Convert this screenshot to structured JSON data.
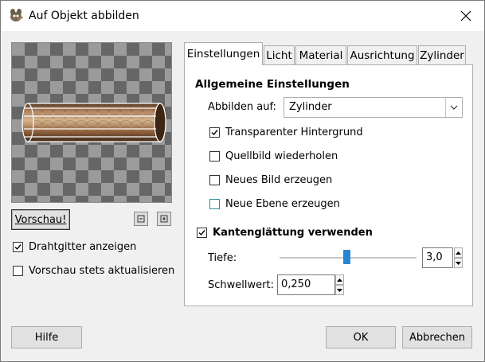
{
  "window": {
    "title": "Auf Objekt abbilden",
    "close_label": "✕"
  },
  "preview": {
    "preview_button": "Vorschau!",
    "wireframe_label": "Drahtgitter anzeigen",
    "wireframe_checked": true,
    "autoupdate_label": "Vorschau stets aktualisieren",
    "autoupdate_checked": false
  },
  "tabs": [
    {
      "label": "Einstellungen",
      "active": true
    },
    {
      "label": "Licht",
      "active": false
    },
    {
      "label": "Material",
      "active": false
    },
    {
      "label": "Ausrichtung",
      "active": false
    },
    {
      "label": "Zylinder",
      "active": false
    }
  ],
  "settings": {
    "section_title": "Allgemeine Einstellungen",
    "map_to_label": "Abbilden auf:",
    "map_to_value": "Zylinder",
    "transparent_bg_label": "Transparenter Hintergrund",
    "transparent_bg_checked": true,
    "tile_source_label": "Quellbild wiederholen",
    "tile_source_checked": false,
    "new_image_label": "Neues Bild erzeugen",
    "new_image_checked": false,
    "new_layer_label": "Neue Ebene erzeugen",
    "new_layer_checked": false,
    "antialias_label": "Kantenglättung verwenden",
    "antialias_checked": true,
    "depth_label": "Tiefe:",
    "depth_value": "3,0",
    "depth_level": 0.5,
    "threshold_label": "Schwellwert:",
    "threshold_value": "0,250"
  },
  "footer": {
    "help_button": "Hilfe",
    "ok_button": "OK",
    "cancel_button": "Abbrechen"
  },
  "colors": {
    "accent": "#2a84d6",
    "teal_checkbox": "#2d8ea0"
  }
}
